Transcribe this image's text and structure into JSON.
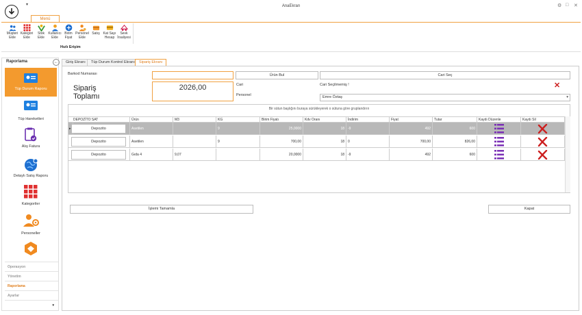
{
  "window": {
    "title": "AnaEkran",
    "controls": [
      "⚙",
      "□",
      "✕"
    ]
  },
  "qat_arrow": "▾",
  "ribbon": {
    "tab": "Menü",
    "group_label": "Hızlı Erişim",
    "buttons": [
      {
        "label": "Müşteri Ekle",
        "icon": "customers-icon"
      },
      {
        "label": "Kategori Ekle",
        "icon": "categories-icon"
      },
      {
        "label": "Stok Ekle",
        "icon": "stock-icon"
      },
      {
        "label": "Kullanıcı Ekle",
        "icon": "user-add-icon"
      },
      {
        "label": "Birim Fiyat",
        "icon": "unit-price-icon"
      },
      {
        "label": "Personel Ekle",
        "icon": "staff-add-icon"
      },
      {
        "label": "Satış",
        "icon": "sale-icon"
      },
      {
        "label": "Kat Sayı Hesap",
        "icon": "card-icon"
      },
      {
        "label": "Sevk İrsaliyesi",
        "icon": "shipping-icon"
      }
    ]
  },
  "sidebar": {
    "title": "Raporlama",
    "back_glyph": "←",
    "items": [
      {
        "label": "Tüp Durum Raporu",
        "icon": "id-card-icon",
        "active": true
      },
      {
        "label": "Tüp Hareketleri",
        "icon": "id-card-icon",
        "active": false
      },
      {
        "label": "Alış Fatura",
        "icon": "clipboard-check-icon",
        "active": false
      },
      {
        "label": "Detaylı Satış Raporu",
        "icon": "globe-icon",
        "active": false
      },
      {
        "label": "Kategoriler",
        "icon": "grid-icon",
        "active": false
      },
      {
        "label": "Personeller",
        "icon": "staff-gear-icon",
        "active": false
      },
      {
        "label": "",
        "icon": "hands-icon",
        "active": false
      }
    ],
    "bottom_groups": [
      {
        "label": "Operasyon",
        "color": "#aaaaaa"
      },
      {
        "label": "Yönetim",
        "color": "#aaaaaa"
      },
      {
        "label": "Raporlama",
        "color": "#e08020"
      },
      {
        "label": "Ayarlar",
        "color": "#aaaaaa"
      }
    ],
    "footer_arrow": "▾"
  },
  "doc_tabs": [
    "Giriş Ekranı",
    "Tüp Durum Kontrol Ekranı",
    "Sipariş Ekranı"
  ],
  "form": {
    "barcode_label": "Barkod Numarası",
    "barcode_value": "",
    "find_product_button": "Ürün Bul",
    "select_account_button": "Cari Seç",
    "order_total_title": "Sipariş Toplamı",
    "order_total_value": "2026,00",
    "account_label": "Cari",
    "account_value": "Cari Seçilmemiş !",
    "staff_label": "Personel",
    "staff_value": "Emre Öztaş",
    "staff_arrow": "▾",
    "clear_glyph": "✕"
  },
  "grid": {
    "group_hint": "Bir sütun başlığını buraya sürükleyerek o sütuna göre gruplandırın",
    "columns": [
      "DEPOZİTO SAT",
      "Ürün",
      "M3",
      "KG",
      "Birim Fiyatı",
      "Kdv Oranı",
      "İndirim",
      "Fiyat",
      "Tutar",
      "Kaydı Düzenle",
      "Kaydı Sil"
    ],
    "row_pointer": "▸",
    "rows": [
      {
        "deposit": "Depozito",
        "product": "Asetilen",
        "m3": "",
        "kg": "9",
        "unit_price": "25,0000",
        "vat": "18",
        "discount": "-9",
        "price": "492",
        "total": "600",
        "selected": true
      },
      {
        "deposit": "Depozito",
        "product": "Asetilen",
        "m3": "",
        "kg": "9",
        "unit_price": "700,00",
        "vat": "18",
        "discount": "0",
        "price": "700,00",
        "total": "826,00",
        "selected": false
      },
      {
        "deposit": "Depozito",
        "product": "Gıda 4",
        "m3": "9,07",
        "kg": "",
        "unit_price": "20,0000",
        "vat": "18",
        "discount": "-9",
        "price": "492",
        "total": "600",
        "selected": false
      }
    ]
  },
  "footer": {
    "complete_button": "İşlemi Tamamla",
    "close_button": "Kapat"
  },
  "colors": {
    "accent": "#f39a2e",
    "edit_icon": "#7a2fb5",
    "delete_icon": "#cc1f1f"
  }
}
